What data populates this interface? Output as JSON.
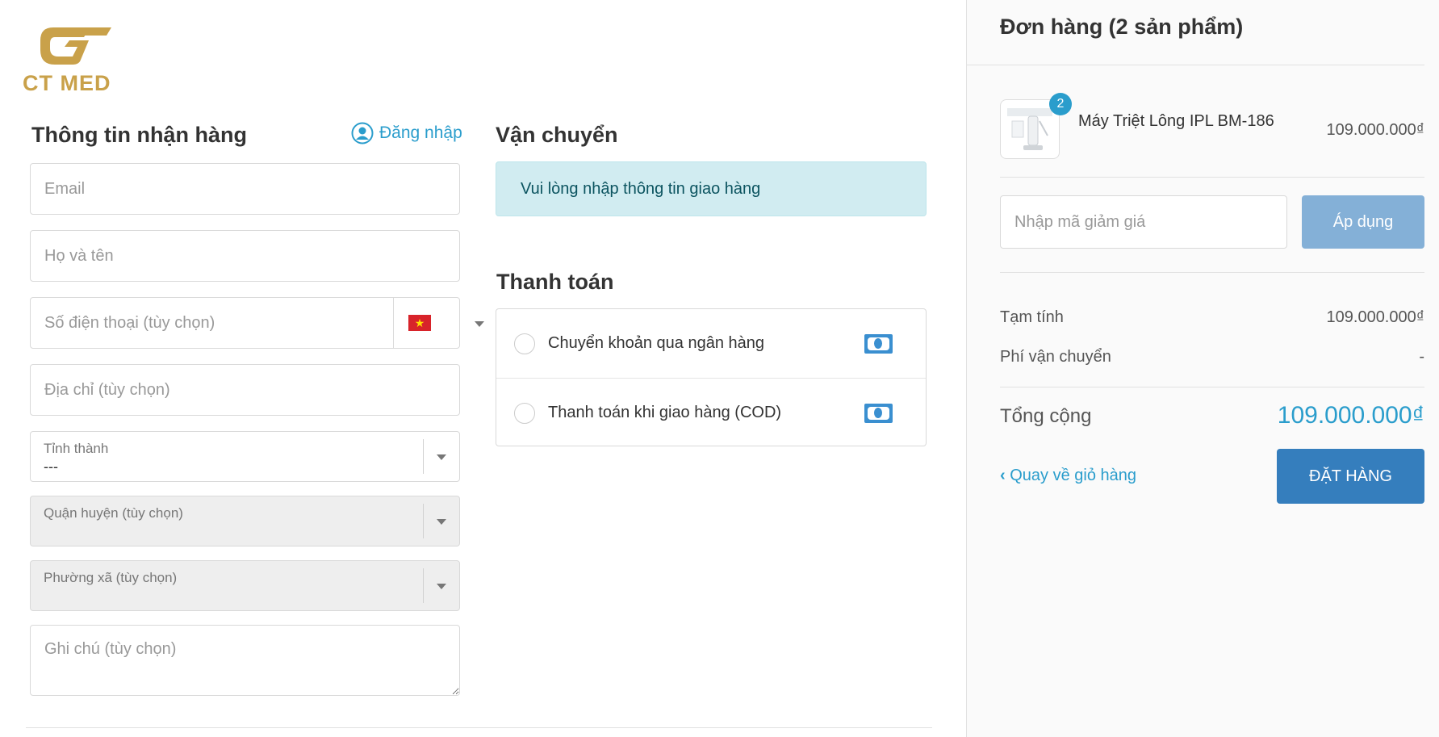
{
  "brand": {
    "name": "CT MED",
    "color": "#c9a14a"
  },
  "accent": "#2a9dcc",
  "shipping_info": {
    "title": "Thông tin nhận hàng",
    "login_label": "Đăng nhập",
    "email_placeholder": "Email",
    "name_placeholder": "Họ và tên",
    "phone_placeholder": "Số điện thoại (tùy chọn)",
    "address_placeholder": "Địa chỉ (tùy chọn)",
    "province_label": "Tỉnh thành",
    "province_value": "---",
    "district_label": "Quận huyện (tùy chọn)",
    "ward_label": "Phường xã (tùy chọn)",
    "note_placeholder": "Ghi chú (tùy chọn)"
  },
  "delivery": {
    "title": "Vận chuyển",
    "message": "Vui lòng nhập thông tin giao hàng"
  },
  "payment": {
    "title": "Thanh toán",
    "methods": [
      {
        "label": "Chuyển khoản qua ngân hàng",
        "icon": "cash-icon"
      },
      {
        "label": "Thanh toán khi giao hàng (COD)",
        "icon": "cash-icon"
      }
    ]
  },
  "order": {
    "title": "Đơn hàng (2 sản phẩm)",
    "items": [
      {
        "name": "Máy Triệt Lông IPL BM-186",
        "quantity": "2",
        "price": "109.000.000₫"
      }
    ],
    "discount_placeholder": "Nhập mã giảm giá",
    "apply_label": "Áp dụng",
    "subtotal_label": "Tạm tính",
    "subtotal_value": "109.000.000₫",
    "shipping_label": "Phí vận chuyển",
    "shipping_value": "-",
    "total_label": "Tổng cộng",
    "total_value": "109.000.000₫",
    "back_label": "Quay về giỏ hàng",
    "submit_label": "ĐẶT HÀNG"
  }
}
